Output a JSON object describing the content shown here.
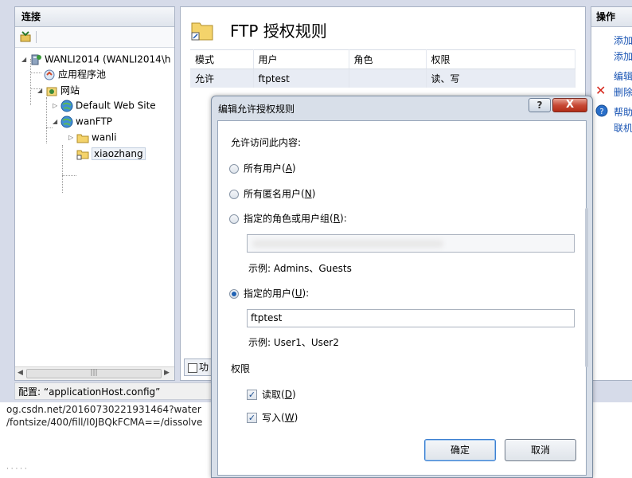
{
  "connections": {
    "title": "连接",
    "tree": {
      "server": "WANLI2014 (WANLI2014\\h",
      "app_pools": "应用程序池",
      "sites": "网站",
      "default_site": "Default Web Site",
      "ftp_site": "wanFTP",
      "folder_wanli": "wanli",
      "folder_xiaozhang": "xiaozhang"
    }
  },
  "feature": {
    "title": "FTP 授权规则",
    "columns": [
      "模式",
      "用户",
      "角色",
      "权限"
    ],
    "rows": [
      {
        "mode": "允许",
        "user": "ftptest",
        "role": "",
        "perm": "读、写"
      }
    ],
    "tab_label": "功"
  },
  "actions": {
    "title": "操作",
    "items": [
      "添加",
      "添加",
      "编辑",
      "删除",
      "帮助",
      "联机"
    ]
  },
  "status_bar": {
    "text": "配置: “applicationHost.config”"
  },
  "background": {
    "url_line_1": "og.csdn.net/20160730221931464?water",
    "url_line_2": "/fontsize/400/fill/I0JBQkFCMA==/dissolve"
  },
  "dialog": {
    "title": "编辑允许授权规则",
    "help_label": "?",
    "close_label": "X",
    "allow_access_label": "允许访问此内容:",
    "radio_all_users": {
      "label": "所有用户",
      "key": "A",
      "checked": false
    },
    "radio_anonymous": {
      "label": "所有匿名用户",
      "key": "N",
      "checked": false
    },
    "radio_roles": {
      "label": "指定的角色或用户组",
      "key": "R",
      "checked": false
    },
    "roles_value": "",
    "roles_example": "示例: Admins、Guests",
    "radio_users": {
      "label": "指定的用户",
      "key": "U",
      "checked": true
    },
    "users_value": "ftptest",
    "users_example": "示例: User1、User2",
    "permissions_label": "权限",
    "check_read": {
      "label": "读取",
      "key": "D",
      "checked": true
    },
    "check_write": {
      "label": "写入",
      "key": "W",
      "checked": true
    },
    "ok_label": "确定",
    "cancel_label": "取消"
  },
  "colors": {
    "accent": "#1f62b4",
    "link": "#1a55b4",
    "close_button": "#c84a36"
  },
  "icons": [
    "toolbar-connect-icon",
    "server-icon",
    "app-pool-icon",
    "sites-icon",
    "globe-icon",
    "folder-icon",
    "feature-folder-icon",
    "delete-icon",
    "help-icon"
  ]
}
